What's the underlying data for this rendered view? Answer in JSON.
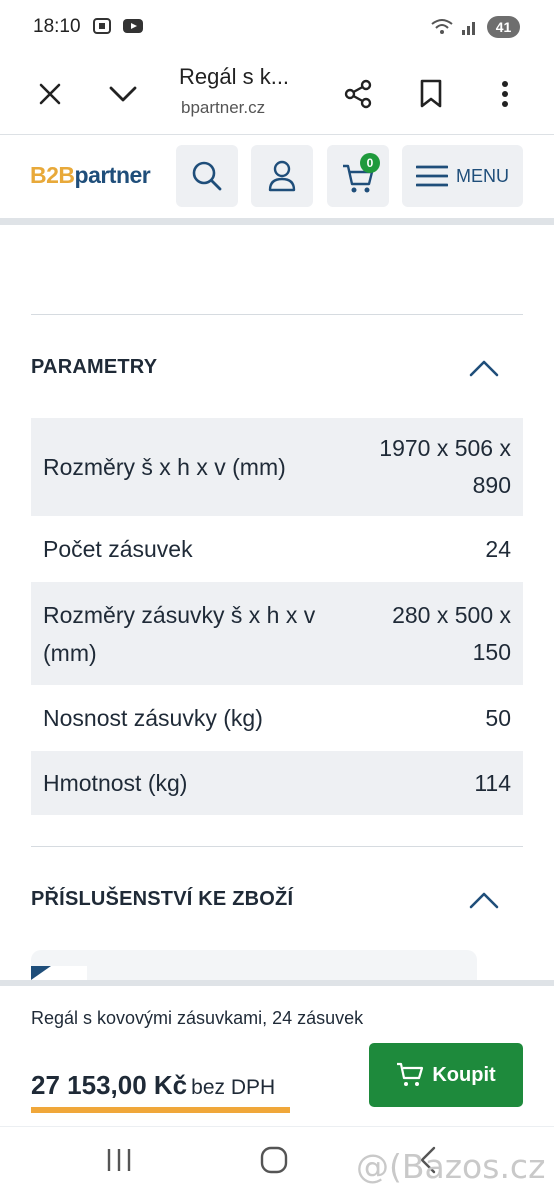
{
  "status_bar": {
    "time": "18:10",
    "battery": "41"
  },
  "browser": {
    "page_title": "Regál s k...",
    "url": "bpartner.cz"
  },
  "site_header": {
    "logo_b2b": "B2B",
    "logo_partner": "partner",
    "cart_count": "0",
    "menu_label": "MENU"
  },
  "parameters": {
    "title": "PARAMETRY",
    "rows": [
      {
        "label": "Rozměry š x h x v (mm)",
        "value": "1970 x 506 x 890"
      },
      {
        "label": "Počet zásuvek",
        "value": "24"
      },
      {
        "label": "Rozměry zásuvky š x h x v (mm)",
        "value": "280 x 500 x 150"
      },
      {
        "label": "Nosnost zásuvky (kg)",
        "value": "50"
      },
      {
        "label": "Hmotnost (kg)",
        "value": "114"
      }
    ]
  },
  "accessories": {
    "title": "PŘÍSLUŠENSTVÍ KE ZBOŽÍ"
  },
  "buy_bar": {
    "product_name": "Regál s kovovými zásuvkami, 24 zásuvek",
    "price": "27 153,00 Kč",
    "tax_note": "bez DPH",
    "buy_label": "Koupit"
  },
  "watermark": "@(Bazos.cz",
  "colors": {
    "brand_blue": "#1f4e7a",
    "brand_orange": "#e8a93a",
    "buy_green": "#1e8a3c",
    "badge_green": "#1f9a3c"
  }
}
